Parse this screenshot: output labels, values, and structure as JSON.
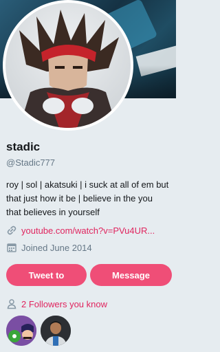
{
  "profile": {
    "name": "stadic",
    "handle": "@Stadic777",
    "bio": "roy | sol | akatsuki | i suck at all of em but that just how it be | believe in the you that believes in yourself",
    "link": "youtube.com/watch?v=PVu4UR...",
    "joined": "Joined June 2014"
  },
  "actions": {
    "tweet_to": "Tweet to",
    "message": "Message"
  },
  "followers": {
    "label": "2 Followers you know"
  },
  "icons": {
    "link": "link-icon",
    "calendar": "calendar-icon",
    "person": "person-icon"
  },
  "colors": {
    "accent": "#ef4e77",
    "link": "#e0245e",
    "muted": "#657786",
    "background": "#e6ecf0"
  }
}
